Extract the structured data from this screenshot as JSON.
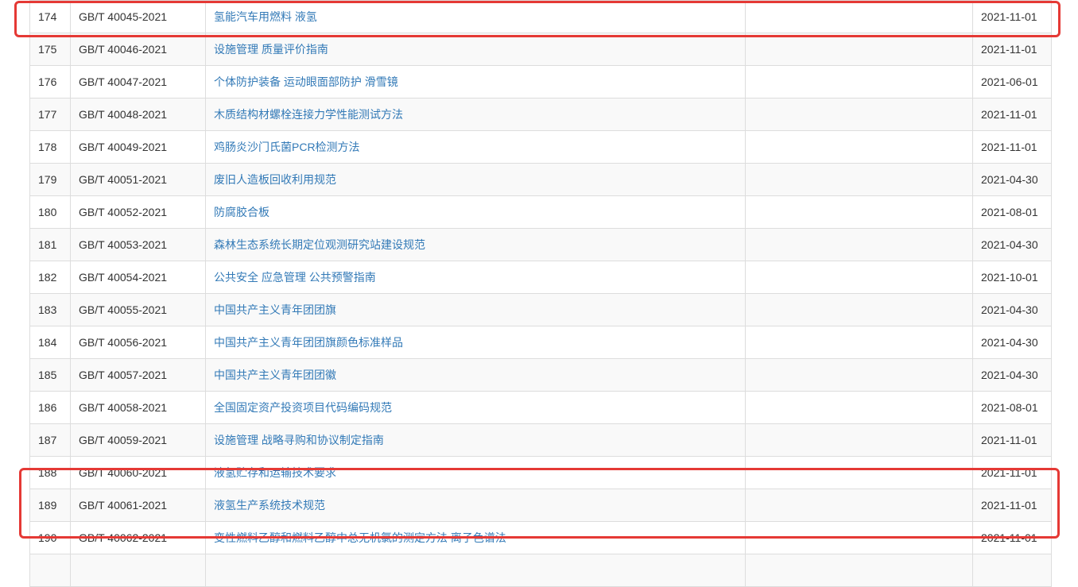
{
  "colors": {
    "link": "#337ab7",
    "highlight": "#e53935",
    "border": "#dddddd",
    "stripe": "#f9f9f9"
  },
  "rows": [
    {
      "num": "174",
      "code": "GB/T 40045-2021",
      "name": "氢能汽车用燃料 液氢",
      "note": "",
      "date": "2021-11-01"
    },
    {
      "num": "175",
      "code": "GB/T 40046-2021",
      "name": "设施管理 质量评价指南",
      "note": "",
      "date": "2021-11-01"
    },
    {
      "num": "176",
      "code": "GB/T 40047-2021",
      "name": "个体防护装备 运动眼面部防护 滑雪镜",
      "note": "",
      "date": "2021-06-01"
    },
    {
      "num": "177",
      "code": "GB/T 40048-2021",
      "name": "木质结构材螺栓连接力学性能测试方法",
      "note": "",
      "date": "2021-11-01"
    },
    {
      "num": "178",
      "code": "GB/T 40049-2021",
      "name": "鸡肠炎沙门氏菌PCR检测方法",
      "note": "",
      "date": "2021-11-01"
    },
    {
      "num": "179",
      "code": "GB/T 40051-2021",
      "name": "废旧人造板回收利用规范",
      "note": "",
      "date": "2021-04-30"
    },
    {
      "num": "180",
      "code": "GB/T 40052-2021",
      "name": "防腐胶合板",
      "note": "",
      "date": "2021-08-01"
    },
    {
      "num": "181",
      "code": "GB/T 40053-2021",
      "name": "森林生态系统长期定位观测研究站建设规范",
      "note": "",
      "date": "2021-04-30"
    },
    {
      "num": "182",
      "code": "GB/T 40054-2021",
      "name": "公共安全 应急管理 公共预警指南",
      "note": "",
      "date": "2021-10-01"
    },
    {
      "num": "183",
      "code": "GB/T 40055-2021",
      "name": "中国共产主义青年团团旗",
      "note": "",
      "date": "2021-04-30"
    },
    {
      "num": "184",
      "code": "GB/T 40056-2021",
      "name": "中国共产主义青年团团旗颜色标准样品",
      "note": "",
      "date": "2021-04-30"
    },
    {
      "num": "185",
      "code": "GB/T 40057-2021",
      "name": "中国共产主义青年团团徽",
      "note": "",
      "date": "2021-04-30"
    },
    {
      "num": "186",
      "code": "GB/T 40058-2021",
      "name": "全国固定资产投资项目代码编码规范",
      "note": "",
      "date": "2021-08-01"
    },
    {
      "num": "187",
      "code": "GB/T 40059-2021",
      "name": "设施管理 战略寻购和协议制定指南",
      "note": "",
      "date": "2021-11-01"
    },
    {
      "num": "188",
      "code": "GB/T 40060-2021",
      "name": "液氢贮存和运输技术要求",
      "note": "",
      "date": "2021-11-01"
    },
    {
      "num": "189",
      "code": "GB/T 40061-2021",
      "name": "液氢生产系统技术规范",
      "note": "",
      "date": "2021-11-01"
    },
    {
      "num": "190",
      "code": "GB/T 40062-2021",
      "name": "变性燃料乙醇和燃料乙醇中总无机氯的测定方法 离子色谱法",
      "note": "",
      "date": "2021-11-01"
    },
    {
      "num": "",
      "code": "",
      "name": "",
      "note": "",
      "date": ""
    }
  ]
}
